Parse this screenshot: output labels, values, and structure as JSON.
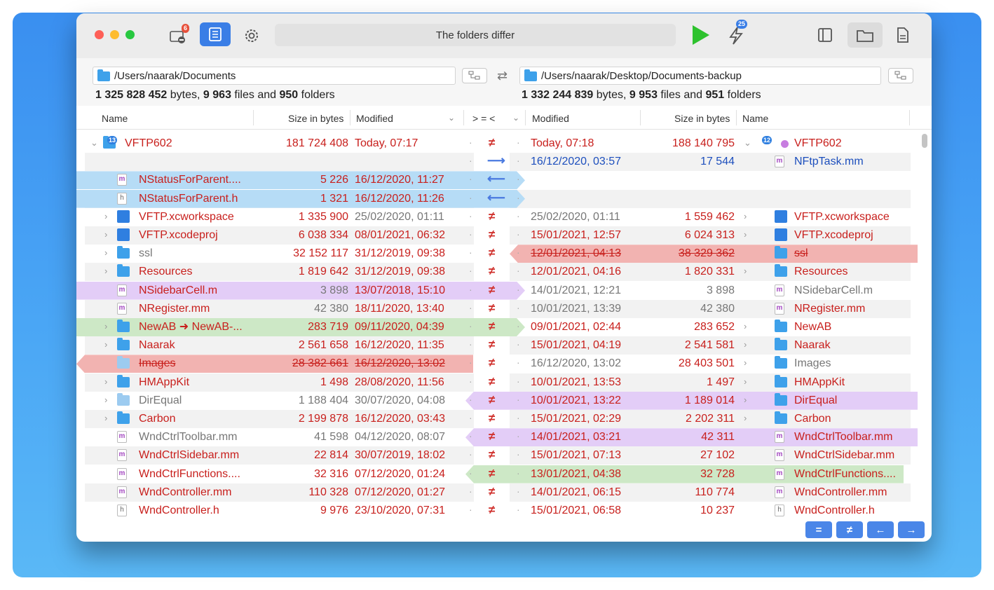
{
  "window": {
    "status": "The folders differ",
    "notification_badge": "6",
    "sync_badge": "25"
  },
  "left": {
    "path": "/Users/naarak/Documents",
    "summary": {
      "bytes": "1 325 828 452",
      "bytes_text": "bytes,",
      "files": "9 963",
      "files_text": "files and",
      "folders": "950",
      "folders_text": "folders"
    }
  },
  "right": {
    "path": "/Users/naarak/Desktop/Documents-backup",
    "summary": {
      "bytes": "1 332 244 839",
      "bytes_text": "bytes,",
      "files": "9 953",
      "files_text": "files and",
      "folders": "951",
      "folders_text": "folders"
    }
  },
  "columns": {
    "name": "Name",
    "size": "Size in bytes",
    "modified": "Modified",
    "compare": "> = <",
    "r_modified": "Modified",
    "r_size": "Size in bytes",
    "r_name": "Name"
  },
  "colors": {
    "red": "#c8201d",
    "blue_band": "#b6dcf6",
    "purple_band": "#e3cdf7",
    "green_band": "#cde8c6",
    "red_band": "#f2b3b1",
    "accent": "#4a86e8"
  },
  "rows": [
    {
      "lname": "VFTP602",
      "lsize": "181 724 408",
      "ldate": "Today, 07:17",
      "rdate": "Today, 07:18",
      "rsize": "188 140 795",
      "rname": "VFTP602",
      "lbadge": "13",
      "rbadge": "12"
    },
    {
      "lname": "",
      "lsize": "",
      "ldate": "",
      "rdate": "16/12/2020, 03:57",
      "rsize": "17 544",
      "rname": "NFtpTask.mm"
    },
    {
      "lname": "NStatusForParent....",
      "lsize": "5 226",
      "ldate": "16/12/2020, 11:27",
      "rdate": "",
      "rsize": "",
      "rname": ""
    },
    {
      "lname": "NStatusForParent.h",
      "lsize": "1 321",
      "ldate": "16/12/2020, 11:26",
      "rdate": "",
      "rsize": "",
      "rname": ""
    },
    {
      "lname": "VFTP.xcworkspace",
      "lsize": "1 335 900",
      "ldate": "25/02/2020, 01:11",
      "rdate": "25/02/2020, 01:11",
      "rsize": "1 559 462",
      "rname": "VFTP.xcworkspace"
    },
    {
      "lname": "VFTP.xcodeproj",
      "lsize": "6 038 334",
      "ldate": "08/01/2021, 06:32",
      "rdate": "15/01/2021, 12:57",
      "rsize": "6 024 313",
      "rname": "VFTP.xcodeproj"
    },
    {
      "lname": "ssl",
      "lsize": "32 152 117",
      "ldate": "31/12/2019, 09:38",
      "rdate": "12/01/2021, 04:13",
      "rsize": "38 329 362",
      "rname": "ssl"
    },
    {
      "lname": "Resources",
      "lsize": "1 819 642",
      "ldate": "31/12/2019, 09:38",
      "rdate": "12/01/2021, 04:16",
      "rsize": "1 820 331",
      "rname": "Resources"
    },
    {
      "lname": "NSidebarCell.m",
      "lsize": "3 898",
      "ldate": "13/07/2018, 15:10",
      "rdate": "14/01/2021, 12:21",
      "rsize": "3 898",
      "rname": "NSidebarCell.m"
    },
    {
      "lname": "NRegister.mm",
      "lsize": "42 380",
      "ldate": "18/11/2020, 13:40",
      "rdate": "10/01/2021, 13:39",
      "rsize": "42 380",
      "rname": "NRegister.mm"
    },
    {
      "lname": "NewAB ➜ NewAB-...",
      "lsize": "283 719",
      "ldate": "09/11/2020, 04:39",
      "rdate": "09/01/2021, 02:44",
      "rsize": "283 652",
      "rname": "NewAB"
    },
    {
      "lname": "Naarak",
      "lsize": "2 561 658",
      "ldate": "16/12/2020, 11:35",
      "rdate": "15/01/2021, 04:19",
      "rsize": "2 541 581",
      "rname": "Naarak"
    },
    {
      "lname": "Images",
      "lsize": "28 382 661",
      "ldate": "16/12/2020, 13:02",
      "rdate": "16/12/2020, 13:02",
      "rsize": "28 403 501",
      "rname": "Images"
    },
    {
      "lname": "HMAppKit",
      "lsize": "1 498",
      "ldate": "28/08/2020, 11:56",
      "rdate": "10/01/2021, 13:53",
      "rsize": "1 497",
      "rname": "HMAppKit"
    },
    {
      "lname": "DirEqual",
      "lsize": "1 188 404",
      "ldate": "30/07/2020, 04:08",
      "rdate": "10/01/2021, 13:22",
      "rsize": "1 189 014",
      "rname": "DirEqual"
    },
    {
      "lname": "Carbon",
      "lsize": "2 199 878",
      "ldate": "16/12/2020, 03:43",
      "rdate": "15/01/2021, 02:29",
      "rsize": "2 202 311",
      "rname": "Carbon"
    },
    {
      "lname": "WndCtrlToolbar.mm",
      "lsize": "41 598",
      "ldate": "04/12/2020, 08:07",
      "rdate": "14/01/2021, 03:21",
      "rsize": "42 311",
      "rname": "WndCtrlToolbar.mm"
    },
    {
      "lname": "WndCtrlSidebar.mm",
      "lsize": "22 814",
      "ldate": "30/07/2019, 18:02",
      "rdate": "15/01/2021, 07:13",
      "rsize": "27 102",
      "rname": "WndCtrlSidebar.mm"
    },
    {
      "lname": "WndCtrlFunctions....",
      "lsize": "32 316",
      "ldate": "07/12/2020, 01:24",
      "rdate": "13/01/2021, 04:38",
      "rsize": "32 728",
      "rname": "WndCtrlFunctions...."
    },
    {
      "lname": "WndController.mm",
      "lsize": "110 328",
      "ldate": "07/12/2020, 01:27",
      "rdate": "14/01/2021, 06:15",
      "rsize": "110 774",
      "rname": "WndController.mm"
    },
    {
      "lname": "WndController.h",
      "lsize": "9 976",
      "ldate": "23/10/2020, 07:31",
      "rdate": "15/01/2021, 06:58",
      "rsize": "10 237",
      "rname": "WndController.h"
    }
  ],
  "footer": {
    "equal": "=",
    "diff": "≠",
    "left": "←",
    "right": "→"
  }
}
